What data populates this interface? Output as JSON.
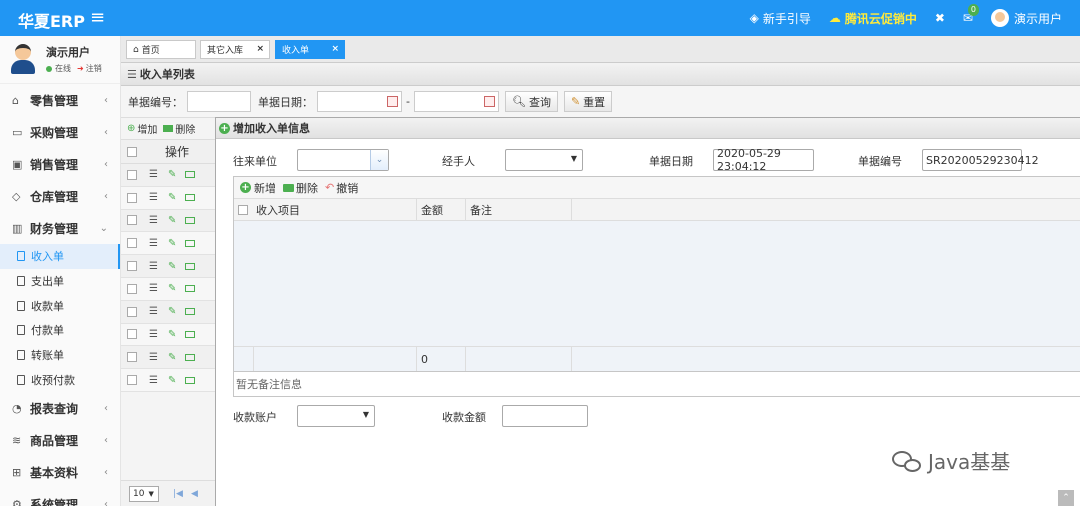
{
  "header": {
    "brand": "华夏ERP",
    "guide": "新手引导",
    "promo": "腾讯云促销中",
    "mail_badge": "0",
    "user": "演示用户"
  },
  "sidebar": {
    "user_name": "演示用户",
    "status_online": "在线",
    "status_logout": "注销",
    "items": [
      {
        "label": "零售管理",
        "icon": "shop-icon"
      },
      {
        "label": "采购管理",
        "icon": "monitor-icon"
      },
      {
        "label": "销售管理",
        "icon": "briefcase-icon"
      },
      {
        "label": "仓库管理",
        "icon": "layers-icon"
      },
      {
        "label": "财务管理",
        "icon": "book-icon"
      }
    ],
    "finance_sub": [
      "收入单",
      "支出单",
      "收款单",
      "付款单",
      "转账单",
      "收预付款"
    ],
    "items_after": [
      {
        "label": "报表查询",
        "icon": "pie-icon"
      },
      {
        "label": "商品管理",
        "icon": "stack-icon"
      },
      {
        "label": "基本资料",
        "icon": "grid-icon"
      },
      {
        "label": "系统管理",
        "icon": "gear-icon"
      }
    ]
  },
  "tabs": {
    "home": "首页",
    "other_in": "其它入库",
    "income": "收入单"
  },
  "list": {
    "title": "收入单列表",
    "doc_no_label": "单据编号：",
    "date_label": "单据日期：",
    "date_sep": "-",
    "query": "查询",
    "reset": "重置",
    "add": "增加",
    "delete": "删除",
    "ops_header": "操作",
    "page_size": "10"
  },
  "form": {
    "title": "增加收入单信息",
    "org_label": "往来单位",
    "handler_label": "经手人",
    "date_label": "单据日期",
    "date_value": "2020-05-29 23:04:12",
    "no_label": "单据编号",
    "no_value": "SR20200529230412",
    "new_btn": "新增",
    "del_btn": "删除",
    "undo_btn": "撤销",
    "col_item": "收入项目",
    "col_amount": "金额",
    "col_remark": "备注",
    "total": "0",
    "remark_placeholder": "暂无备注信息",
    "account_label": "收款账户",
    "amount_label": "收款金额"
  },
  "watermark": "Java基基",
  "colors": {
    "primary": "#2196F3",
    "promo": "#FFEB3B",
    "add_green": "#4CAF50"
  }
}
